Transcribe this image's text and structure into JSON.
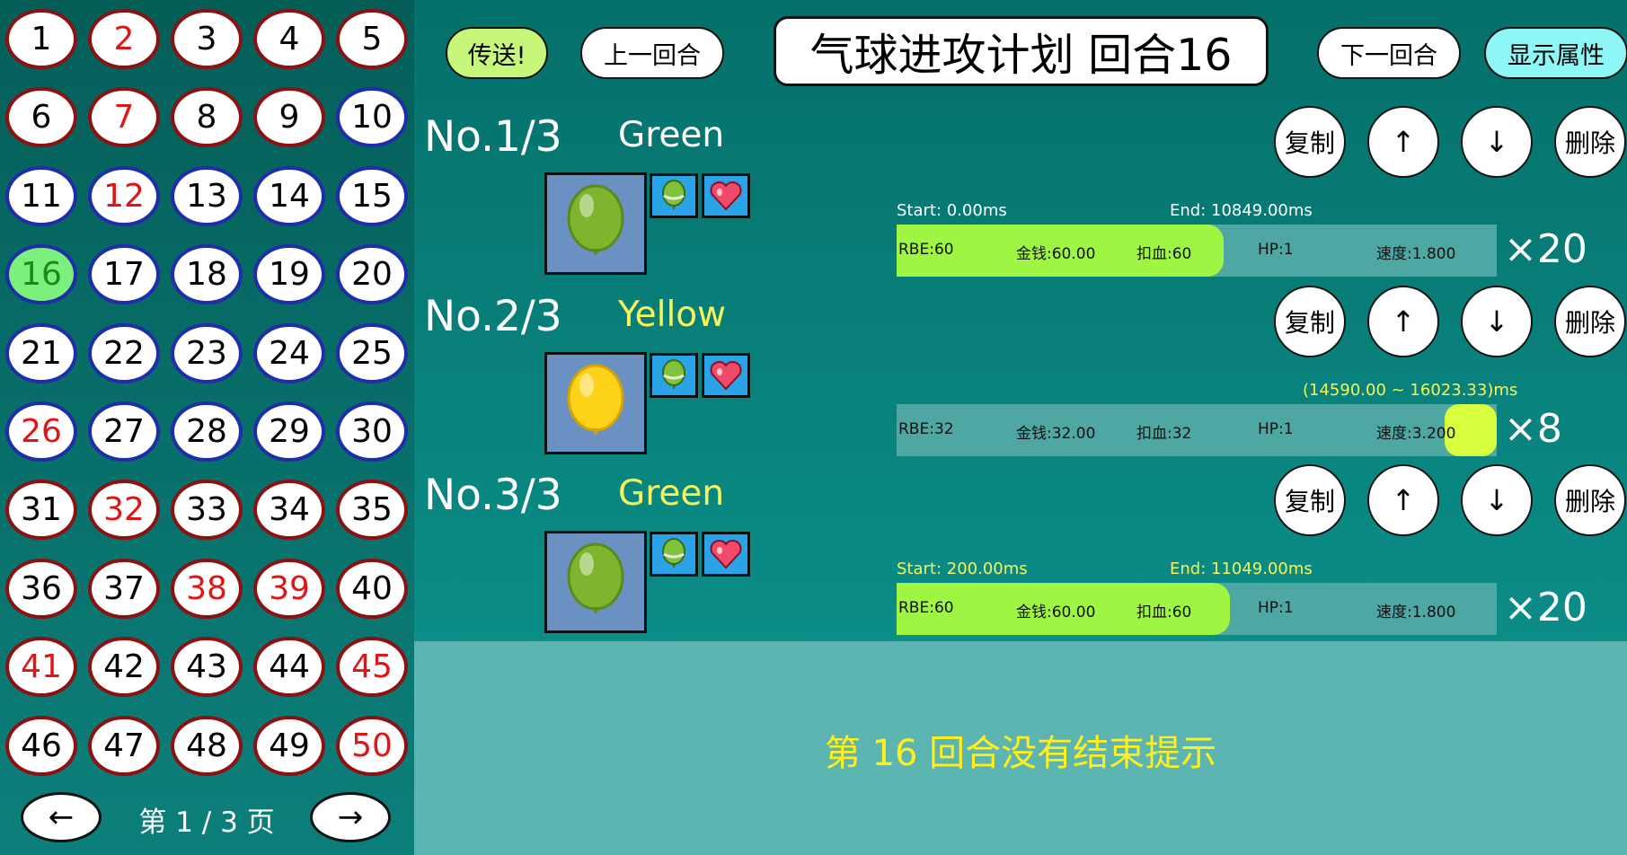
{
  "sidebar": {
    "rounds": [
      {
        "n": "1",
        "border": "red",
        "text": "black"
      },
      {
        "n": "2",
        "border": "red",
        "text": "red"
      },
      {
        "n": "3",
        "border": "red",
        "text": "black"
      },
      {
        "n": "4",
        "border": "red",
        "text": "black"
      },
      {
        "n": "5",
        "border": "red",
        "text": "black"
      },
      {
        "n": "6",
        "border": "red",
        "text": "black"
      },
      {
        "n": "7",
        "border": "red",
        "text": "red"
      },
      {
        "n": "8",
        "border": "red",
        "text": "black"
      },
      {
        "n": "9",
        "border": "red",
        "text": "black"
      },
      {
        "n": "10",
        "border": "blue",
        "text": "black"
      },
      {
        "n": "11",
        "border": "blue",
        "text": "black"
      },
      {
        "n": "12",
        "border": "blue",
        "text": "red"
      },
      {
        "n": "13",
        "border": "blue",
        "text": "black"
      },
      {
        "n": "14",
        "border": "blue",
        "text": "black"
      },
      {
        "n": "15",
        "border": "blue",
        "text": "black"
      },
      {
        "n": "16",
        "border": "blue",
        "text": "current"
      },
      {
        "n": "17",
        "border": "blue",
        "text": "black"
      },
      {
        "n": "18",
        "border": "blue",
        "text": "black"
      },
      {
        "n": "19",
        "border": "blue",
        "text": "black"
      },
      {
        "n": "20",
        "border": "blue",
        "text": "black"
      },
      {
        "n": "21",
        "border": "blue",
        "text": "black"
      },
      {
        "n": "22",
        "border": "blue",
        "text": "black"
      },
      {
        "n": "23",
        "border": "blue",
        "text": "black"
      },
      {
        "n": "24",
        "border": "blue",
        "text": "black"
      },
      {
        "n": "25",
        "border": "blue",
        "text": "black"
      },
      {
        "n": "26",
        "border": "blue",
        "text": "red"
      },
      {
        "n": "27",
        "border": "blue",
        "text": "black"
      },
      {
        "n": "28",
        "border": "blue",
        "text": "black"
      },
      {
        "n": "29",
        "border": "blue",
        "text": "black"
      },
      {
        "n": "30",
        "border": "blue",
        "text": "black"
      },
      {
        "n": "31",
        "border": "red",
        "text": "black"
      },
      {
        "n": "32",
        "border": "red",
        "text": "red"
      },
      {
        "n": "33",
        "border": "red",
        "text": "black"
      },
      {
        "n": "34",
        "border": "red",
        "text": "black"
      },
      {
        "n": "35",
        "border": "red",
        "text": "black"
      },
      {
        "n": "36",
        "border": "red",
        "text": "black"
      },
      {
        "n": "37",
        "border": "red",
        "text": "black"
      },
      {
        "n": "38",
        "border": "red",
        "text": "red"
      },
      {
        "n": "39",
        "border": "red",
        "text": "red"
      },
      {
        "n": "40",
        "border": "red",
        "text": "black"
      },
      {
        "n": "41",
        "border": "red",
        "text": "red"
      },
      {
        "n": "42",
        "border": "red",
        "text": "black"
      },
      {
        "n": "43",
        "border": "red",
        "text": "black"
      },
      {
        "n": "44",
        "border": "red",
        "text": "black"
      },
      {
        "n": "45",
        "border": "red",
        "text": "red"
      },
      {
        "n": "46",
        "border": "red",
        "text": "black"
      },
      {
        "n": "47",
        "border": "red",
        "text": "black"
      },
      {
        "n": "48",
        "border": "red",
        "text": "black"
      },
      {
        "n": "49",
        "border": "red",
        "text": "black"
      },
      {
        "n": "50",
        "border": "red",
        "text": "red"
      }
    ],
    "prev_label": "←",
    "next_label": "→",
    "page_label": "第 1 / 3 页"
  },
  "toolbar": {
    "send_label": "传送!",
    "prev_round_label": "上一回合",
    "title": "气球进攻计划 回合16",
    "next_round_label": "下一回合",
    "show_attr_label": "显示属性"
  },
  "colors": {
    "send_bg": "#c6f77a",
    "show_attr_bg": "#8ff6f6",
    "name_white": "#ffffff",
    "name_yellow": "#f6f45a",
    "fill_green": "#9ef542",
    "fill_lime": "#d8ff3e"
  },
  "waves": [
    {
      "no": "No.1/3",
      "name": "Green",
      "name_color": "white",
      "balloon": "green-balloon",
      "copy": "复制",
      "up": "↑",
      "down": "↓",
      "delete": "删除",
      "start": "Start: 0.00ms",
      "end": "End: 10849.00ms",
      "range": "",
      "rbe": "RBE:60",
      "money": "金钱:60.00",
      "damage": "扣血:60",
      "hp": "HP:1",
      "speed": "速度:1.800",
      "count": "×20",
      "time_color": "white",
      "fill_fraction": 0.545,
      "mark": false
    },
    {
      "no": "No.2/3",
      "name": "Yellow",
      "name_color": "yellow",
      "balloon": "yellow-balloon",
      "copy": "复制",
      "up": "↑",
      "down": "↓",
      "delete": "删除",
      "start": "",
      "end": "",
      "range": "(14590.00 ~ 16023.33)ms",
      "rbe": "RBE:32",
      "money": "金钱:32.00",
      "damage": "扣血:32",
      "hp": "HP:1",
      "speed": "速度:3.200",
      "count": "×8",
      "time_color": "yellow",
      "fill_fraction": 0,
      "mark": true
    },
    {
      "no": "No.3/3",
      "name": "Green",
      "name_color": "yellow",
      "balloon": "green-balloon",
      "copy": "复制",
      "up": "↑",
      "down": "↓",
      "delete": "删除",
      "start": "Start: 200.00ms",
      "end": "End: 11049.00ms",
      "range": "",
      "rbe": "RBE:60",
      "money": "金钱:60.00",
      "damage": "扣血:60",
      "hp": "HP:1",
      "speed": "速度:1.800",
      "count": "×20",
      "time_color": "yellow",
      "fill_fraction": 0.555,
      "mark": false
    }
  ],
  "hint": "第 16 回合没有结束提示"
}
